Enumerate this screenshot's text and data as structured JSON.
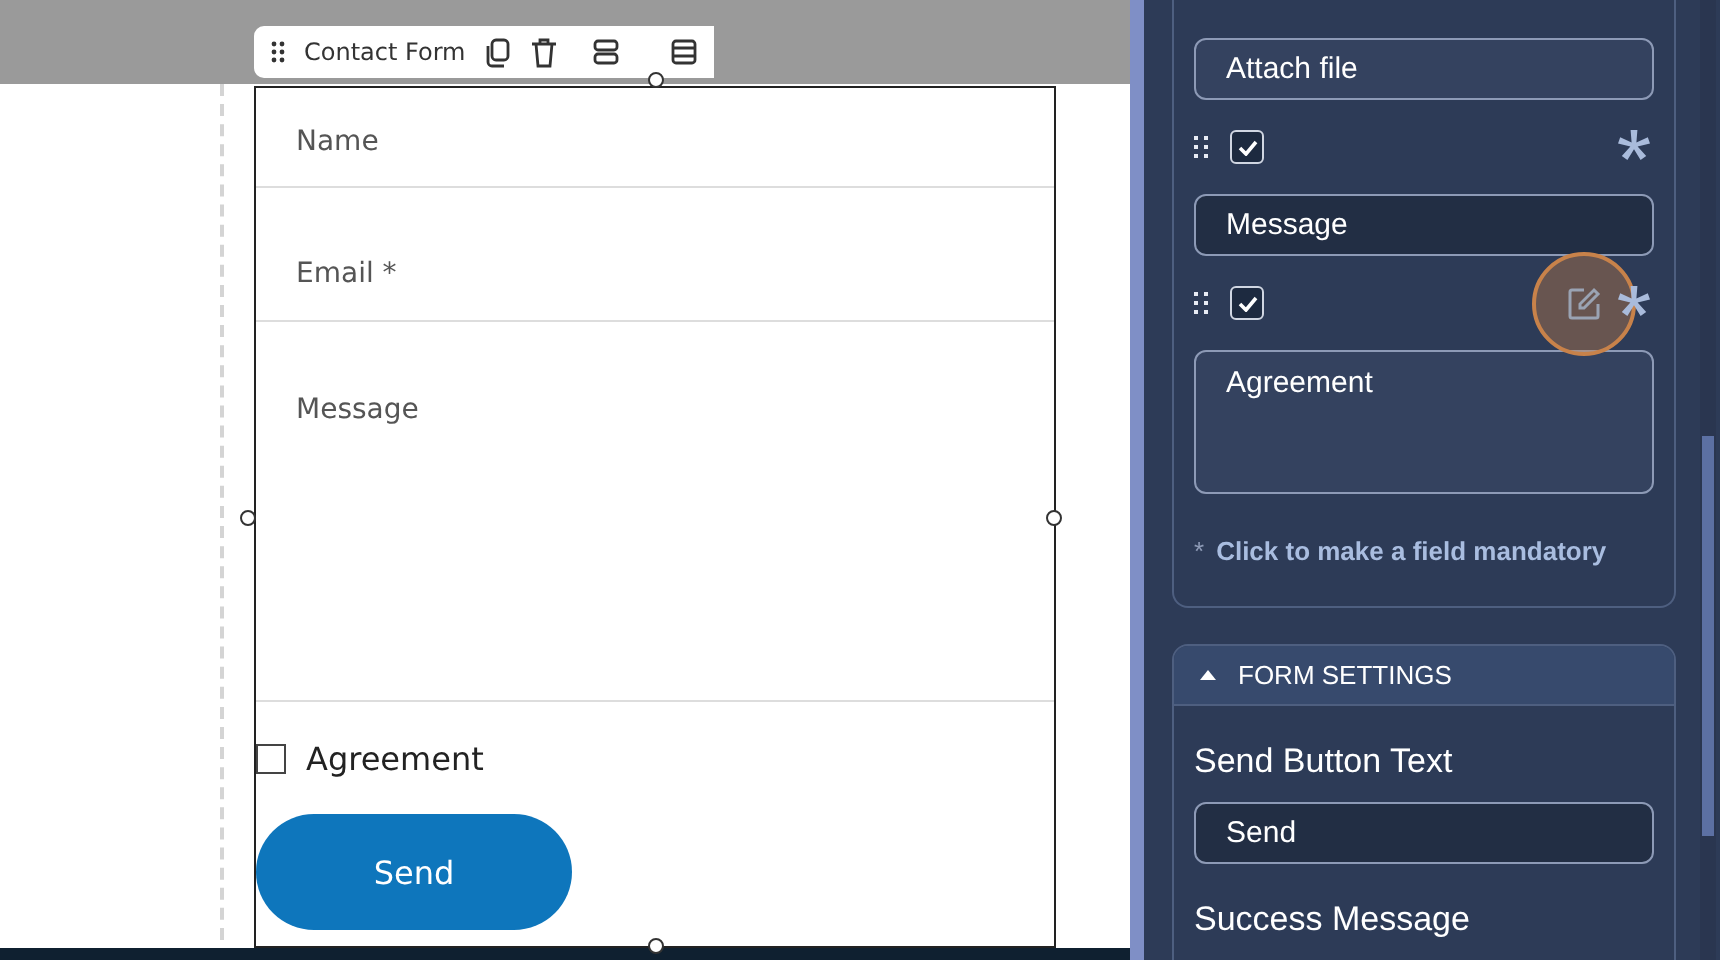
{
  "toolbar": {
    "title": "Contact Form"
  },
  "form": {
    "fields": [
      {
        "kind": "text",
        "label": "Name"
      },
      {
        "kind": "text",
        "label": "Email *"
      },
      {
        "kind": "textarea",
        "label": "Message"
      },
      {
        "kind": "checkbox",
        "label": "Agreement",
        "checked": false
      }
    ],
    "send_button": "Send"
  },
  "panel": {
    "rows": [
      {
        "kind": "field",
        "label": "Attach file",
        "selected": false
      },
      {
        "kind": "controls",
        "checked": true,
        "hovered": false
      },
      {
        "kind": "field",
        "label": "Message",
        "selected": true
      },
      {
        "kind": "controls",
        "checked": true,
        "hovered": true
      },
      {
        "kind": "area",
        "label": "Agreement",
        "selected": false
      }
    ],
    "hint_mark": "*",
    "hint": "Click to make a field mandatory",
    "section": {
      "title": "FORM SETTINGS",
      "expanded": true
    },
    "send_label": "Send Button Text",
    "send_value": "Send",
    "success_label": "Success Message"
  }
}
